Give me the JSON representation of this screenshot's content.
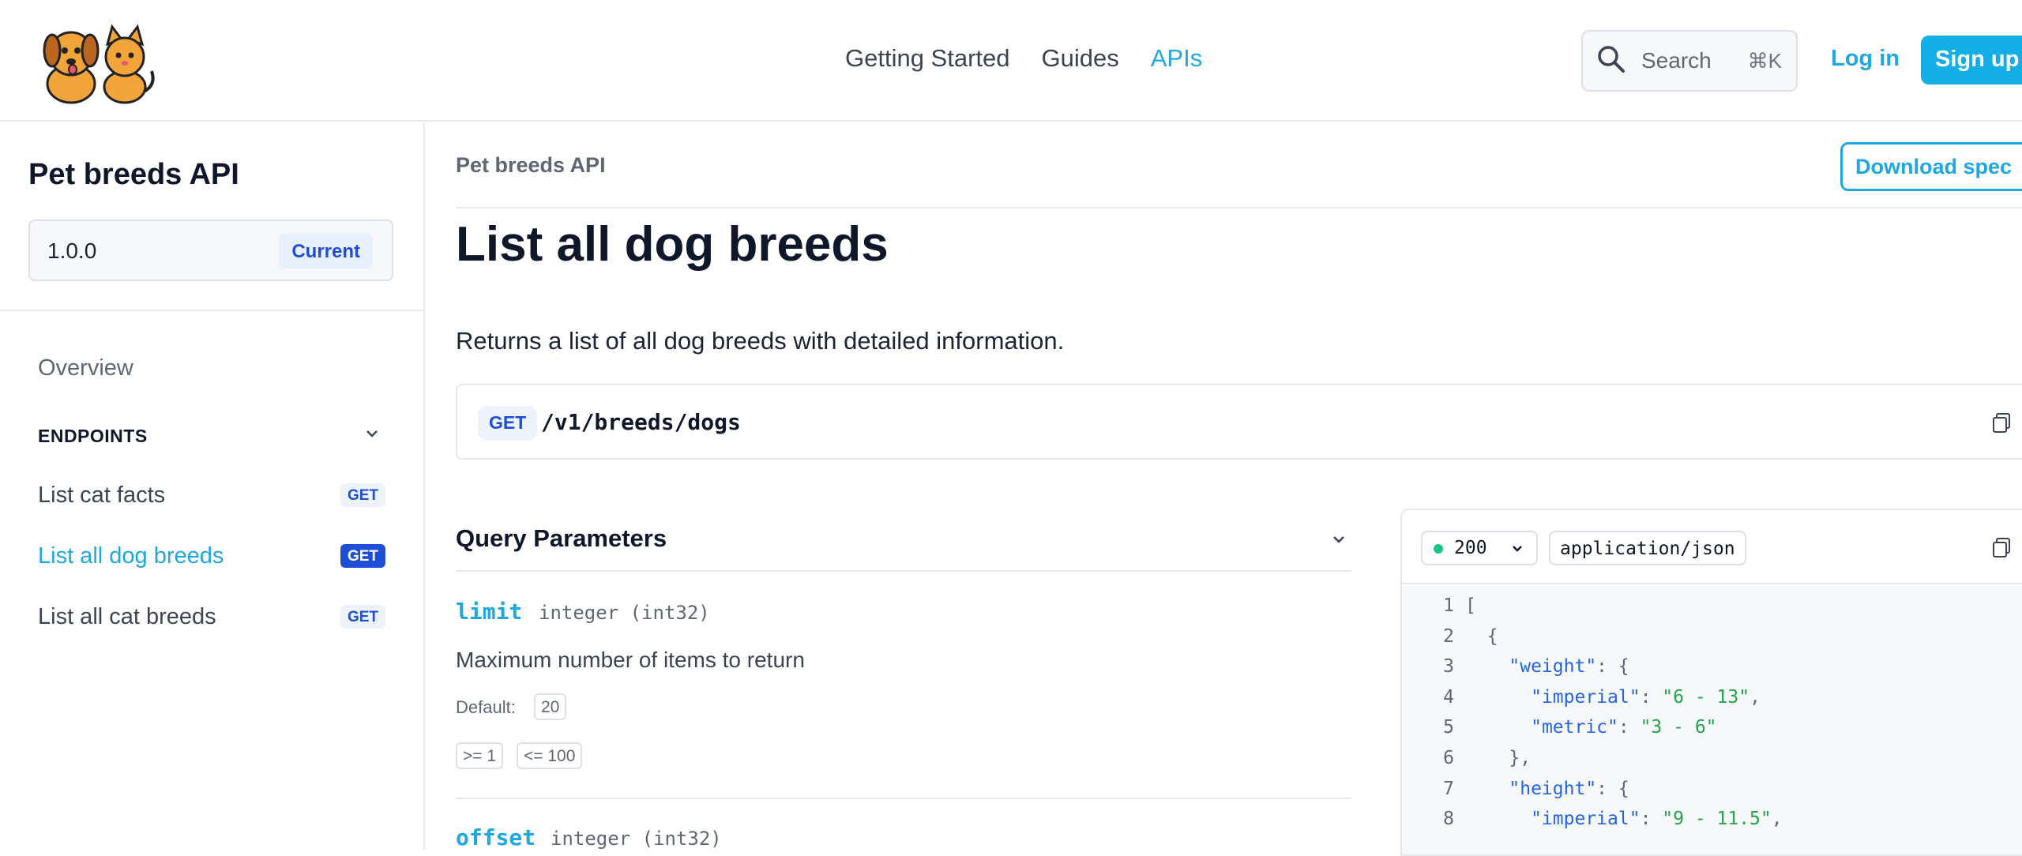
{
  "header": {
    "logo_icon": "dog-and-cat-logo",
    "nav": [
      {
        "label": "Getting Started",
        "active": false
      },
      {
        "label": "Guides",
        "active": false
      },
      {
        "label": "APIs",
        "active": true
      }
    ],
    "search": {
      "icon": "search-icon",
      "label": "Search",
      "shortcut": "⌘K"
    },
    "login_label": "Log in",
    "signup_label": "Sign up"
  },
  "sidebar": {
    "title": "Pet breeds API",
    "version": {
      "value": "1.0.0",
      "badge": "Current"
    },
    "overview_label": "Overview",
    "endpoints_heading": "ENDPOINTS",
    "endpoints": [
      {
        "label": "List cat facts",
        "method": "GET",
        "active": false
      },
      {
        "label": "List all dog breeds",
        "method": "GET",
        "active": true
      },
      {
        "label": "List all cat breeds",
        "method": "GET",
        "active": false
      }
    ]
  },
  "main": {
    "breadcrumb": "Pet breeds API",
    "download_label": "Download spec",
    "title": "List all dog breeds",
    "description": "Returns a list of all dog breeds with detailed information.",
    "endpoint": {
      "method": "GET",
      "path": "/v1/breeds/dogs"
    },
    "query_params": {
      "title": "Query Parameters",
      "params": [
        {
          "name": "limit",
          "type": "integer (int32)",
          "description": "Maximum number of items to return",
          "default_label": "Default:",
          "default_value": "20",
          "constraints": [
            ">= 1",
            "<= 100"
          ]
        },
        {
          "name": "offset",
          "type": "integer (int32)"
        }
      ]
    },
    "response": {
      "status": "200",
      "status_color": "#16c784",
      "content_type": "application/json",
      "code_lines": [
        {
          "n": "1",
          "indent": "",
          "parts": [
            {
              "t": "[",
              "c": "p"
            }
          ]
        },
        {
          "n": "2",
          "indent": "  ",
          "parts": [
            {
              "t": "{",
              "c": "p"
            }
          ]
        },
        {
          "n": "3",
          "indent": "    ",
          "parts": [
            {
              "t": "\"weight\"",
              "c": "k"
            },
            {
              "t": ": {",
              "c": "p"
            }
          ]
        },
        {
          "n": "4",
          "indent": "      ",
          "parts": [
            {
              "t": "\"imperial\"",
              "c": "k"
            },
            {
              "t": ": ",
              "c": "p"
            },
            {
              "t": "\"6 - 13\"",
              "c": "s"
            },
            {
              "t": ",",
              "c": "p"
            }
          ]
        },
        {
          "n": "5",
          "indent": "      ",
          "parts": [
            {
              "t": "\"metric\"",
              "c": "k"
            },
            {
              "t": ": ",
              "c": "p"
            },
            {
              "t": "\"3 - 6\"",
              "c": "s"
            }
          ]
        },
        {
          "n": "6",
          "indent": "    ",
          "parts": [
            {
              "t": "},",
              "c": "p"
            }
          ]
        },
        {
          "n": "7",
          "indent": "    ",
          "parts": [
            {
              "t": "\"height\"",
              "c": "k"
            },
            {
              "t": ": {",
              "c": "p"
            }
          ]
        },
        {
          "n": "8",
          "indent": "      ",
          "parts": [
            {
              "t": "\"imperial\"",
              "c": "k"
            },
            {
              "t": ": ",
              "c": "p"
            },
            {
              "t": "\"9 - 11.5\"",
              "c": "s"
            },
            {
              "t": ",",
              "c": "p"
            }
          ]
        }
      ]
    }
  },
  "colors": {
    "accent": "#1fa7e0",
    "brand_button": "#14aee6",
    "method_blue": "#1d4ed8"
  }
}
